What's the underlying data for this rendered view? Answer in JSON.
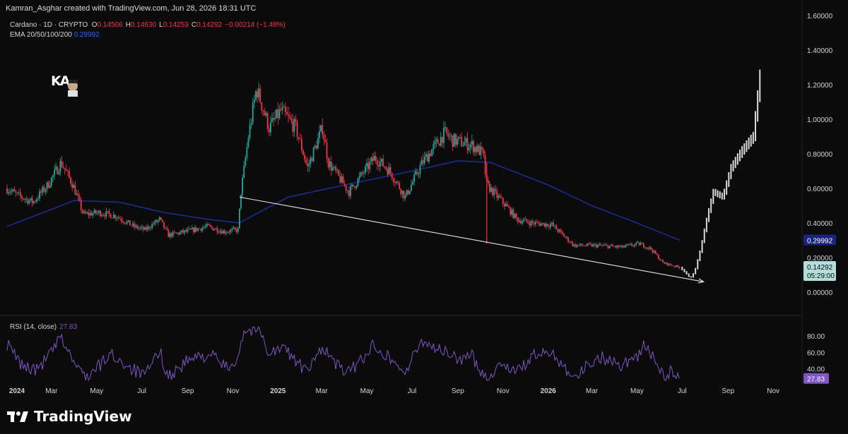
{
  "header": {
    "credit": "Kamran_Asghar created with TradingView.com, Jun 28, 2026 18:31 UTC",
    "symbol": "Cardano · 1D · CRYPTO",
    "o_label": "O",
    "o_value": "0.14506",
    "h_label": "H",
    "h_value": "0.14630",
    "l_label": "L",
    "l_value": "0.14253",
    "c_label": "C",
    "c_value": "0.14292",
    "change": "−0.00214 (−1.48%)",
    "ema_label": "EMA 20/50/100/200",
    "ema_value": "0.29992"
  },
  "logo_text": "KA",
  "footer": {
    "brand": "TradingView"
  },
  "colors": {
    "up": "#26a69a",
    "down": "#f23645",
    "ema": "#1e2a8c",
    "rsi": "#7e57c2",
    "projection": "#d9d9d9"
  },
  "chart_data": [
    {
      "type": "candlestick",
      "title": "Cardano · 1D · CRYPTO",
      "ylim": [
        0,
        1.6
      ],
      "y_ticks": [
        "1.60000",
        "1.40000",
        "1.20000",
        "1.00000",
        "0.80000",
        "0.60000",
        "0.40000",
        "0.20000",
        "0.00000"
      ],
      "x_ticks": [
        "2024",
        "Mar",
        "May",
        "Jul",
        "Sep",
        "Nov",
        "2025",
        "Mar",
        "May",
        "Jul",
        "Sep",
        "Nov",
        "2026",
        "Mar",
        "May",
        "Jul",
        "Sep",
        "Nov"
      ],
      "x_range": [
        "2024-01-01",
        "2026-12-10"
      ],
      "price_path": [
        [
          "2024-01-01",
          0.6
        ],
        [
          "2024-01-15",
          0.56
        ],
        [
          "2024-02-05",
          0.52
        ],
        [
          "2024-02-25",
          0.62
        ],
        [
          "2024-03-14",
          0.75
        ],
        [
          "2024-03-30",
          0.62
        ],
        [
          "2024-04-13",
          0.45
        ],
        [
          "2024-05-05",
          0.46
        ],
        [
          "2024-05-28",
          0.44
        ],
        [
          "2024-06-20",
          0.38
        ],
        [
          "2024-07-05",
          0.36
        ],
        [
          "2024-07-25",
          0.42
        ],
        [
          "2024-08-06",
          0.33
        ],
        [
          "2024-08-30",
          0.35
        ],
        [
          "2024-09-28",
          0.38
        ],
        [
          "2024-10-20",
          0.35
        ],
        [
          "2024-11-08",
          0.36
        ],
        [
          "2024-11-12",
          0.58
        ],
        [
          "2024-11-22",
          0.9
        ],
        [
          "2024-12-03",
          1.18
        ],
        [
          "2024-12-20",
          0.95
        ],
        [
          "2025-01-05",
          1.05
        ],
        [
          "2025-01-25",
          0.95
        ],
        [
          "2025-02-10",
          0.72
        ],
        [
          "2025-03-02",
          0.95
        ],
        [
          "2025-03-10",
          0.75
        ],
        [
          "2025-04-07",
          0.58
        ],
        [
          "2025-05-12",
          0.78
        ],
        [
          "2025-06-01",
          0.7
        ],
        [
          "2025-06-22",
          0.55
        ],
        [
          "2025-07-15",
          0.75
        ],
        [
          "2025-08-14",
          0.92
        ],
        [
          "2025-08-25",
          0.88
        ],
        [
          "2025-09-20",
          0.85
        ],
        [
          "2025-10-05",
          0.8
        ],
        [
          "2025-10-10",
          0.62
        ],
        [
          "2025-11-05",
          0.5
        ],
        [
          "2025-11-20",
          0.42
        ],
        [
          "2025-12-10",
          0.4
        ],
        [
          "2026-01-06",
          0.39
        ],
        [
          "2026-02-05",
          0.27
        ],
        [
          "2026-03-10",
          0.27
        ],
        [
          "2026-04-10",
          0.26
        ],
        [
          "2026-05-05",
          0.28
        ],
        [
          "2026-05-20",
          0.25
        ],
        [
          "2026-06-05",
          0.17
        ],
        [
          "2026-06-28",
          0.143
        ]
      ],
      "ema_200": [
        [
          "2024-01-01",
          0.38
        ],
        [
          "2024-04-01",
          0.53
        ],
        [
          "2024-06-01",
          0.52
        ],
        [
          "2024-08-01",
          0.46
        ],
        [
          "2024-10-01",
          0.42
        ],
        [
          "2024-11-10",
          0.4
        ],
        [
          "2024-12-01",
          0.45
        ],
        [
          "2025-01-15",
          0.55
        ],
        [
          "2025-04-01",
          0.62
        ],
        [
          "2025-07-01",
          0.7
        ],
        [
          "2025-09-01",
          0.76
        ],
        [
          "2025-10-15",
          0.75
        ],
        [
          "2026-01-01",
          0.62
        ],
        [
          "2026-03-01",
          0.5
        ],
        [
          "2026-05-01",
          0.4
        ],
        [
          "2026-06-28",
          0.29992
        ]
      ],
      "trendline": [
        [
          "2024-11-10",
          0.55
        ],
        [
          "2026-07-30",
          0.06
        ]
      ],
      "projection_path": [
        [
          "2026-06-28",
          0.143
        ],
        [
          "2026-07-06",
          0.11
        ],
        [
          "2026-07-12",
          0.08
        ],
        [
          "2026-07-18",
          0.12
        ],
        [
          "2026-07-26",
          0.25
        ],
        [
          "2026-08-02",
          0.4
        ],
        [
          "2026-08-12",
          0.58
        ],
        [
          "2026-08-25",
          0.55
        ],
        [
          "2026-09-05",
          0.72
        ],
        [
          "2026-09-20",
          0.82
        ],
        [
          "2026-10-05",
          0.9
        ],
        [
          "2026-10-14",
          1.25
        ]
      ],
      "last_price": 0.14292,
      "last_price_label": "0.14292",
      "countdown": "05:29:00",
      "ema_label": "0.29992"
    },
    {
      "type": "line",
      "title": "RSI (14, close)",
      "last_value": 27.83,
      "last_value_label": "27.83",
      "ylim": [
        25,
        92
      ],
      "y_ticks": [
        "80.00",
        "60.00",
        "40.00"
      ],
      "rsi_path": [
        [
          "2024-01-01",
          70
        ],
        [
          "2024-01-20",
          45
        ],
        [
          "2024-02-10",
          38
        ],
        [
          "2024-03-05",
          65
        ],
        [
          "2024-03-14",
          78
        ],
        [
          "2024-04-05",
          40
        ],
        [
          "2024-04-20",
          30
        ],
        [
          "2024-05-20",
          58
        ],
        [
          "2024-06-10",
          45
        ],
        [
          "2024-07-05",
          30
        ],
        [
          "2024-07-25",
          62
        ],
        [
          "2024-08-06",
          30
        ],
        [
          "2024-09-01",
          50
        ],
        [
          "2024-10-01",
          58
        ],
        [
          "2024-10-25",
          40
        ],
        [
          "2024-11-08",
          55
        ],
        [
          "2024-11-15",
          85
        ],
        [
          "2024-11-28",
          88
        ],
        [
          "2024-12-05",
          90
        ],
        [
          "2024-12-20",
          60
        ],
        [
          "2025-01-10",
          65
        ],
        [
          "2025-01-30",
          45
        ],
        [
          "2025-02-10",
          35
        ],
        [
          "2025-03-02",
          68
        ],
        [
          "2025-03-20",
          45
        ],
        [
          "2025-04-07",
          35
        ],
        [
          "2025-05-12",
          70
        ],
        [
          "2025-06-05",
          50
        ],
        [
          "2025-06-22",
          35
        ],
        [
          "2025-07-15",
          75
        ],
        [
          "2025-08-14",
          60
        ],
        [
          "2025-09-01",
          52
        ],
        [
          "2025-09-20",
          55
        ],
        [
          "2025-10-10",
          28
        ],
        [
          "2025-11-01",
          48
        ],
        [
          "2025-11-20",
          35
        ],
        [
          "2025-12-10",
          55
        ],
        [
          "2026-01-06",
          60
        ],
        [
          "2026-02-05",
          30
        ],
        [
          "2026-03-10",
          55
        ],
        [
          "2026-04-10",
          45
        ],
        [
          "2026-05-05",
          58
        ],
        [
          "2026-05-12",
          70
        ],
        [
          "2026-05-28",
          45
        ],
        [
          "2026-06-08",
          28
        ],
        [
          "2026-06-15",
          36
        ],
        [
          "2026-06-28",
          27.83
        ]
      ]
    }
  ]
}
